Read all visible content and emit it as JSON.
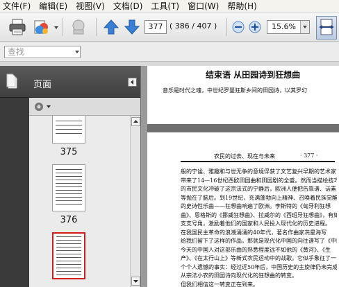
{
  "menu": [
    "文件(F)",
    "编辑(E)",
    "视图(V)",
    "文档(D)",
    "工具(T)",
    "窗口(W)",
    "帮助(H)"
  ],
  "toolbar": {
    "current_page": "377",
    "page_count": "( 386 / 407 )",
    "zoom": "15.6%"
  },
  "find": {
    "placeholder": "查找"
  },
  "panel": {
    "title": "页面",
    "thumbnails": [
      {
        "label": "375"
      },
      {
        "label": "376"
      }
    ]
  },
  "document": {
    "page_a": {
      "title": "结束语  从田园诗到狂想曲",
      "subtitle": "音乐是时代之魂，中世纪罗曼狂斯乡间的田园诗，以其罗幻"
    },
    "page_b": {
      "header_left": "农民的过去、现在与未来",
      "header_right": "· 377 ·",
      "lines": [
        "般的宁谧、雅趣和与世无争的意境俘获了文艺复兴早期的艺术家，",
        "带来了14—16世纪西欧田园曲和田园剧的全盛。然而当描绘技巧",
        "的市民文化冲破了这宗法式的宁静后，欧洲人便把告靠谱、话素",
        "等抛在了脑后。到19世纪，充满蓬勃向上精神、召唤着民族觉醒",
        "的史诗性乐曲——狂想曲响遍了欧洲。李斯特的《匈牙利狂想",
        "曲》、恩格斯的《挪威狂想曲》、拉威尔的《西班牙狂想曲》，有如一",
        "支支号角，激励着他们的国家和人民投入现代化的历史进程。",
        "    在我国民主革命的浪潮涌涌的40年代，著名作曲家冼星海写",
        "给我们留下了这样的作品，那就是现代化中国的向往谱写了《中国狂想曲》。然而",
        "今天的中国人对这部乐曲的熟悉程度远不如他的《黄河》、《生",
        "产》、《在太行山上》等新式农民运动中的战歌。它似乎象征了一",
        "个个人遗憾的事实：经过近50年后，中国历史的主旋律仍未完成",
        "从宗法小农的田园诗向现代化的狂想曲的转变。",
        "    但我们相信这一转变正在到来。"
      ]
    }
  }
}
